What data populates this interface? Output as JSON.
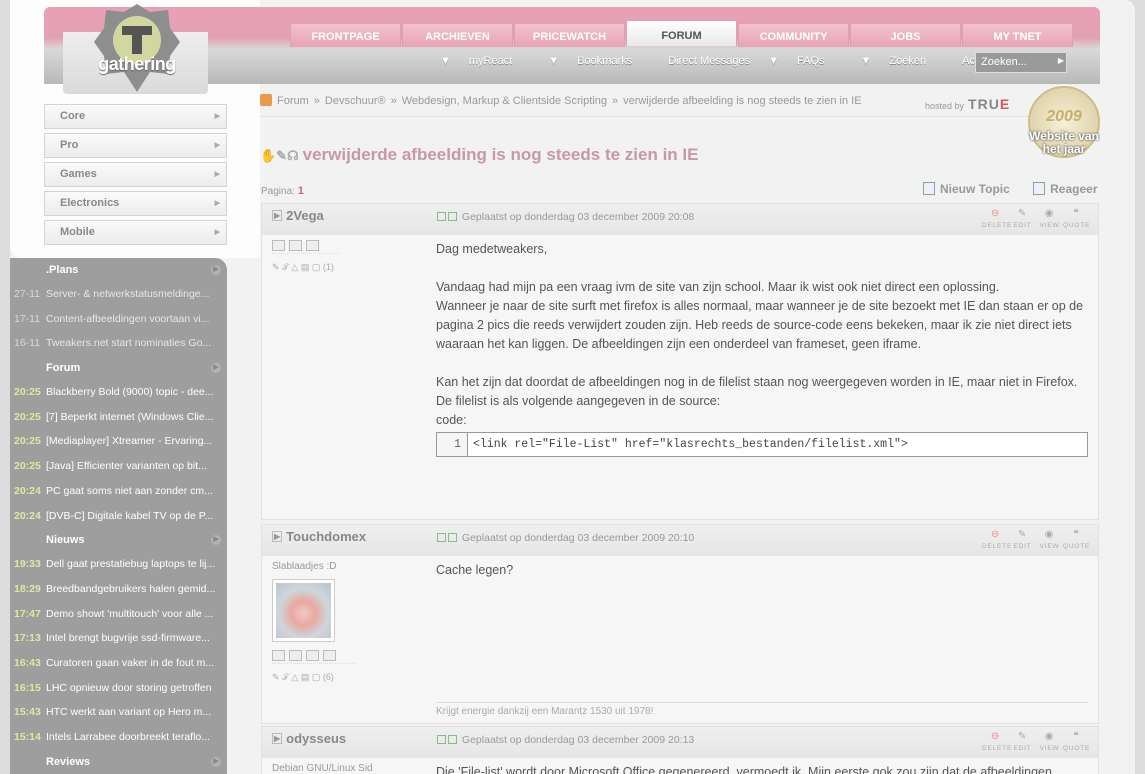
{
  "header": {
    "logo_text": "gathering",
    "tabs": [
      {
        "label": "FRONTPAGE"
      },
      {
        "label": "ARCHIEVEN"
      },
      {
        "label": "PRICEWATCH"
      },
      {
        "label": "FORUM"
      },
      {
        "label": "COMMUNITY"
      },
      {
        "label": "JOBS"
      },
      {
        "label": "MY TNET"
      }
    ],
    "subnav": [
      {
        "label": "myReact"
      },
      {
        "label": "Bookmarks"
      },
      {
        "label": "Direct Messages"
      },
      {
        "label": "FAQs"
      },
      {
        "label": "Zoeken"
      },
      {
        "label": "Active topics"
      }
    ],
    "search_placeholder": "Zoeken..."
  },
  "sidemenu": [
    "Core",
    "Pro",
    "Games",
    "Electronics",
    "Mobile"
  ],
  "sidebar": {
    "plans": {
      "title": ".Plans",
      "items": [
        {
          "time": "27-11",
          "text": "Server- & netwerkstatusmeldinge..."
        },
        {
          "time": "17-11",
          "text": "Content-afbeeldingen voortaan vi..."
        },
        {
          "time": "16-11",
          "text": "Tweakers.net start nominaties Go..."
        }
      ]
    },
    "forum": {
      "title": "Forum",
      "items": [
        {
          "time": "20:25",
          "text": "Blackberry Bold (9000) topic - dee..."
        },
        {
          "time": "20:25",
          "text": "[7] Beperkt internet (Windows Clie..."
        },
        {
          "time": "20:25",
          "text": "[Mediaplayer] Xtreamer - Ervaring..."
        },
        {
          "time": "20:25",
          "text": "[Java] Efficienter varianten op bit..."
        },
        {
          "time": "20:24",
          "text": "PC gaat soms niet aan zonder cm..."
        },
        {
          "time": "20:24",
          "text": "[DVB-C] Digitale kabel TV op de P..."
        }
      ]
    },
    "nieuws": {
      "title": "Nieuws",
      "items": [
        {
          "time": "19:33",
          "text": "Dell gaat prestatiebug laptops te lij..."
        },
        {
          "time": "18:29",
          "text": "Breedbandgebruikers halen gemid..."
        },
        {
          "time": "17:47",
          "text": "Demo showt 'multitouch' voor alle ..."
        },
        {
          "time": "17:13",
          "text": "Intel brengt bugvrije ssd-firmware..."
        },
        {
          "time": "16:43",
          "text": "Curatoren gaan vaker in de fout m..."
        },
        {
          "time": "16:15",
          "text": "LHC opnieuw door storing getroffen"
        },
        {
          "time": "15:43",
          "text": "HTC werkt aan variant op Hero m..."
        },
        {
          "time": "15:14",
          "text": "Intels Larrabee doorbreekt teraflo..."
        }
      ]
    },
    "reviews": {
      "title": "Reviews"
    }
  },
  "breadcrumb": {
    "items": [
      "Forum",
      "Devschuur®",
      "Webdesign, Markup & Clientside Scripting",
      "verwijderde afbeelding is nog steeds te zien in IE"
    ],
    "sep": "»",
    "hosted_by": "hosted by",
    "hosted_brand": "TRU",
    "hosted_brand_end": "E"
  },
  "award": {
    "year": "2009",
    "text": "Website van het jaar"
  },
  "topic": {
    "title": "verwijderde afbeelding is nog steeds te zien in IE",
    "page_label": "Pagina:",
    "page_num": "1",
    "new_topic": "Nieuw Topic",
    "reply": "Reageer"
  },
  "post_buttons": {
    "delete": "DELETE",
    "edit": "EDIT",
    "view": "VIEW",
    "quote": "QUOTE"
  },
  "posts": [
    {
      "author": "2Vega",
      "posted": "Geplaatst op donderdag 03 december 2009 20:08",
      "stats": "(1)",
      "body": [
        "Dag medetweakers,",
        "",
        "Vandaag had mijn pa een vraag ivm de site van zijn school. Maar ik wist ook niet direct een oplossing.",
        "Wanneer je naar de site surft met firefox is alles normaal, maar wanneer je de site bezoekt met IE dan staan er op de pagina 2 pics die reeds verwijdert zouden zijn. Heb reeds de source-code eens bekeken, maar ik zie niet direct iets waaraan het kan liggen. De afbeeldingen zijn een onderdeel van frameset, geen iframe.",
        "",
        "Kan het zijn dat doordat de afbeeldingen nog in de filelist staan nog weergegeven worden in IE, maar niet in Firefox.",
        "De filelist is als volgende aangegeven in de source:",
        "code:"
      ],
      "code_line_no": "1",
      "code": "<link rel=\"File-List\" href=\"klasrechts_bestanden/filelist.xml\">"
    },
    {
      "author": "Touchdomex",
      "posted": "Geplaatst op donderdag 03 december 2009 20:10",
      "usertitle": "Slablaadjes :D",
      "stats": "(6)",
      "body": "Cache legen?",
      "signature": "Krijgt energie dankzij een Marantz 1530 uit 1978!"
    },
    {
      "author": "odysseus",
      "posted": "Geplaatst op donderdag 03 december 2009 20:13",
      "usertitle": "Debian GNU/Linux Sid",
      "body": "Die 'File-list' wordt door Microsoft Office gegenereerd, vermoedt ik. Mijn eerste gok zou zijn dat de afbeeldingen"
    }
  ]
}
